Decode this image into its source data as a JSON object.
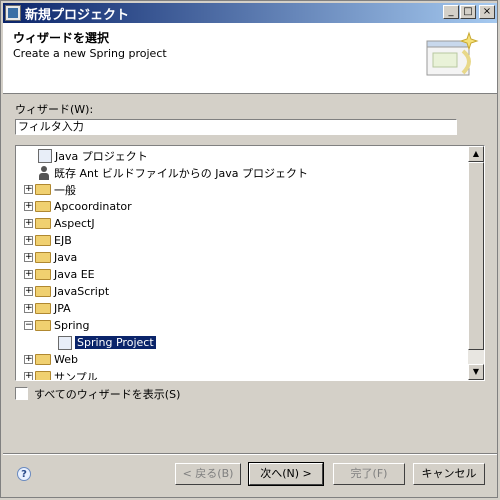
{
  "window": {
    "title": "新規プロジェクト",
    "min_symbol": "_",
    "max_symbol": "□",
    "close_symbol": "×"
  },
  "header": {
    "title": "ウィザードを選択",
    "description": "Create a new Spring project"
  },
  "wizard": {
    "label": "ウィザード(W):",
    "filter_value": "フィルタ入力"
  },
  "tree": {
    "items": [
      {
        "label": "Java プロジェクト",
        "icon": "java-project-icon",
        "level": 1
      },
      {
        "label": "既存 Ant ビルドファイルからの Java プロジェクト",
        "icon": "ant-person-icon",
        "level": 1
      },
      {
        "label": "一般",
        "icon": "folder-icon",
        "expander": "+"
      },
      {
        "label": "Apcoordinator",
        "icon": "folder-icon",
        "expander": "+"
      },
      {
        "label": "AspectJ",
        "icon": "folder-icon",
        "expander": "+"
      },
      {
        "label": "EJB",
        "icon": "folder-icon",
        "expander": "+"
      },
      {
        "label": "Java",
        "icon": "folder-icon",
        "expander": "+"
      },
      {
        "label": "Java EE",
        "icon": "folder-icon",
        "expander": "+"
      },
      {
        "label": "JavaScript",
        "icon": "folder-icon",
        "expander": "+"
      },
      {
        "label": "JPA",
        "icon": "folder-icon",
        "expander": "+"
      },
      {
        "label": "Spring",
        "icon": "folder-open-icon",
        "expander": "−"
      },
      {
        "label": "Spring Project",
        "icon": "spring-project-icon",
        "level": 1,
        "selected": true
      },
      {
        "label": "Web",
        "icon": "folder-icon",
        "expander": "+"
      },
      {
        "label": "サンプル",
        "icon": "folder-icon",
        "expander": "+"
      }
    ],
    "scroll_up": "▲",
    "scroll_down": "▼"
  },
  "show_all": {
    "label": "すべてのウィザードを表示(S)",
    "checked": false
  },
  "buttons": {
    "help": "?",
    "back": "< 戻る(B)",
    "next": "次へ(N) >",
    "finish": "完了(F)",
    "cancel": "キャンセル"
  },
  "colors": {
    "selection": "#0a246a",
    "titlebar": "#0a246a"
  }
}
